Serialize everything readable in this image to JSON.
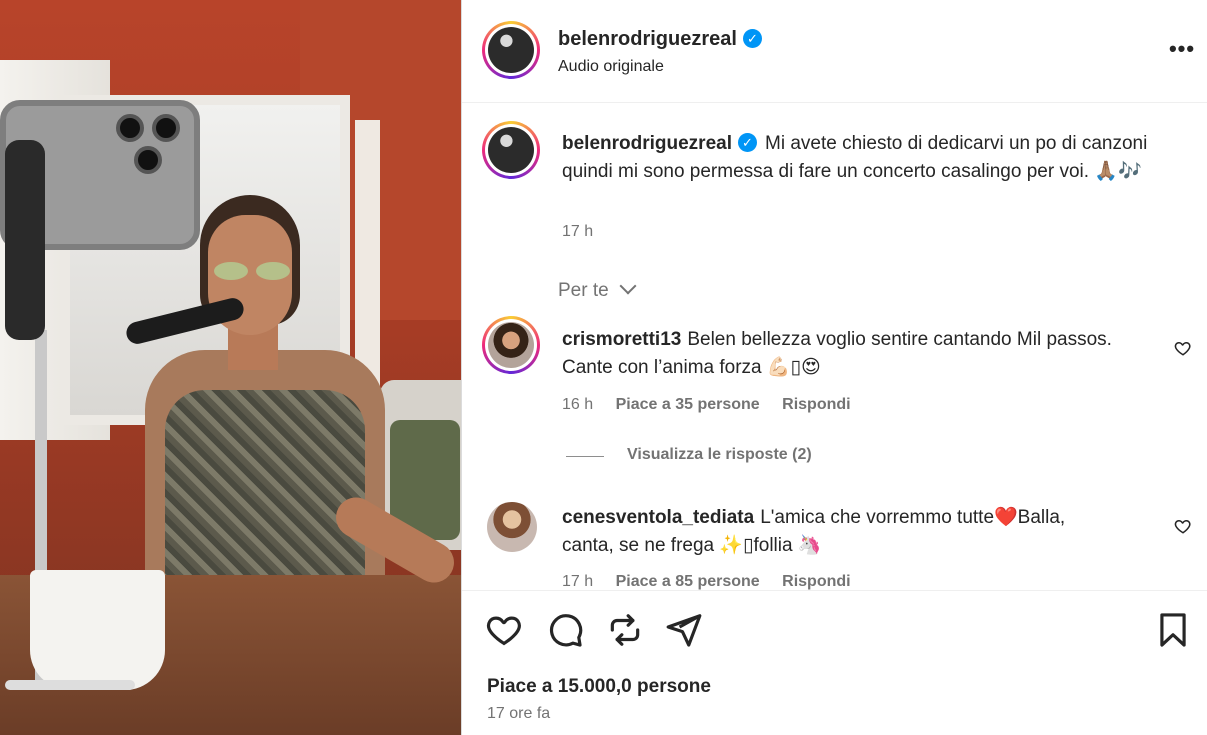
{
  "post": {
    "username": "belenrodriguezreal",
    "audio_label": "Audio originale",
    "verified": true,
    "caption_user": "belenrodriguezreal",
    "caption": "Mi avete chiesto di dedicarvi un po di canzoni quindi mi sono permessa di fare un concerto casalingo per voi. 🙏🏽🎶",
    "caption_time": "17 h"
  },
  "filter": {
    "label": "Per te"
  },
  "comments": [
    {
      "user": "crismoretti13",
      "text": "Belen bellezza voglio sentire cantando Mil passos. Cante con l’anima forza 💪🏻▯😍",
      "time": "16 h",
      "likes": "Piace a 35 persone",
      "reply": "Rispondi",
      "view_replies": "Visualizza le risposte (2)"
    },
    {
      "user": "cenesventola_tediata",
      "text": "L'amica che vorremmo tutte❤️Balla, canta, se ne frega ✨▯follia 🦄",
      "time": "17 h",
      "likes": "Piace a 85 persone",
      "reply": "Rispondi"
    }
  ],
  "footer": {
    "likes": "Piace a 15.000,0 persone",
    "ago": "17 ore fa"
  },
  "icons": {
    "like": "heart-icon",
    "comment": "comment-icon",
    "repost": "repost-icon",
    "share": "share-icon",
    "save": "bookmark-icon",
    "more": "more-icon"
  },
  "colors": {
    "verified": "#0095f6",
    "muted": "#737373",
    "text": "#262626"
  }
}
